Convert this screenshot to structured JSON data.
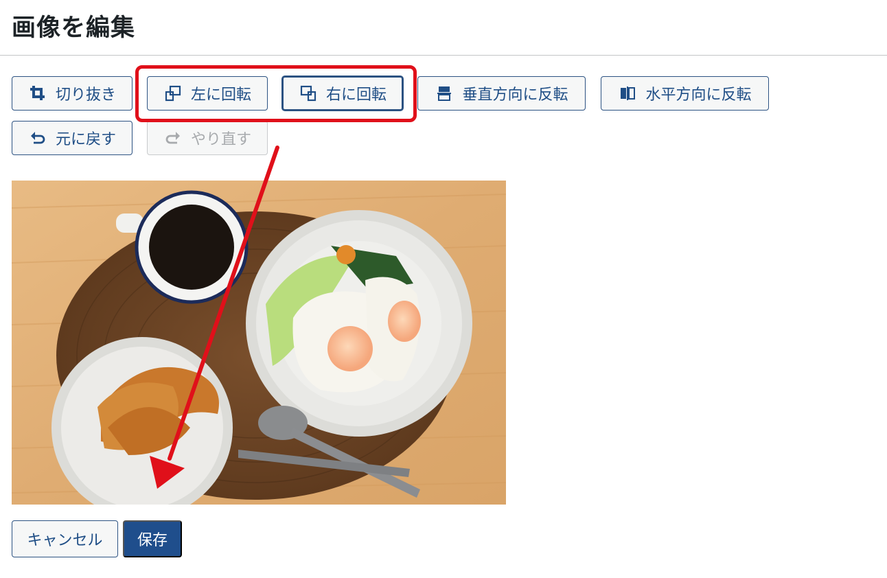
{
  "header": {
    "title": "画像を編集"
  },
  "toolbar": {
    "crop": {
      "label": "切り抜き",
      "icon": "crop-icon"
    },
    "rotate_left": {
      "label": "左に回転",
      "icon": "rotate-left-icon"
    },
    "rotate_right": {
      "label": "右に回転",
      "icon": "rotate-right-icon"
    },
    "flip_vertical": {
      "label": "垂直方向に反転",
      "icon": "flip-vertical-icon"
    },
    "flip_horizontal": {
      "label": "水平方向に反転",
      "icon": "flip-horizontal-icon"
    },
    "undo": {
      "label": "元に戻す",
      "icon": "undo-icon"
    },
    "redo": {
      "label": "やり直す",
      "icon": "redo-icon",
      "disabled": true
    }
  },
  "footer": {
    "cancel_label": "キャンセル",
    "save_label": "保存"
  },
  "colors": {
    "primary": "#1f4e8c",
    "button_border": "#2c5282",
    "disabled": "#a7aaad",
    "annotation": "#e0101a"
  }
}
